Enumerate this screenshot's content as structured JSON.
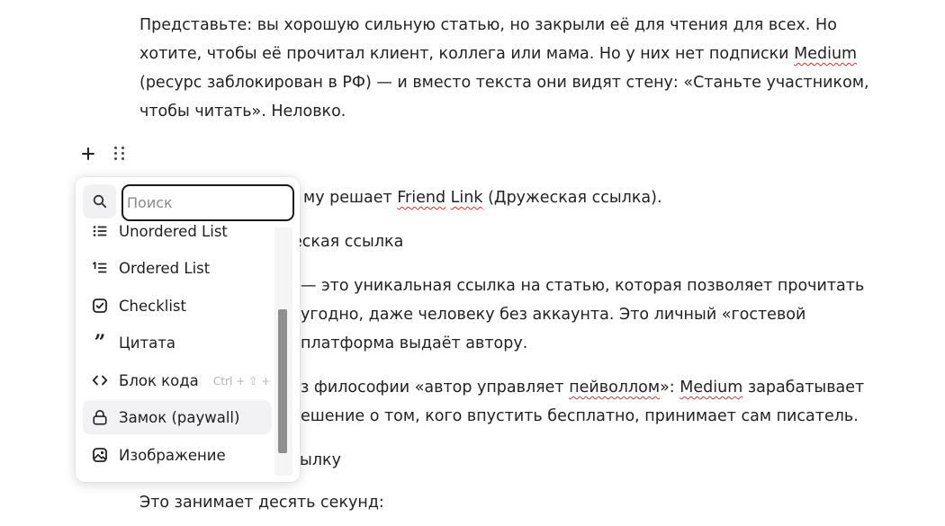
{
  "paragraphs": {
    "intro": {
      "line1": "Представьте: вы хорошую сильную статью, но закрыли её для чтения для всех. Но",
      "line2_a": "хотите, чтобы её прочитал клиент, коллега или мама. Но у них нет подписки ",
      "line2_b": "Medium",
      "line3": "(ресурс заблокирован в РФ) — и вместо текста они видят стену: «Станьте участником,",
      "line4": "чтобы читать». Неловко."
    },
    "p2": {
      "a": "му решает ",
      "b": "Friend",
      "c": " ",
      "d": "Link",
      "e": " (Дружеская ссылка)."
    },
    "p3": "еская ссылка",
    "p4": {
      "line1": "— это уникальная ссылка на статью, которая позволяет прочитать",
      "line2": "угодно, даже человеку без аккаунта. Это личный «гостевой",
      "line3": "платформа выдаёт автору."
    },
    "p5": {
      "line1_a": "з философии «автор управляет ",
      "line1_b": "пейволлом",
      "line1_c": "»: ",
      "line1_d": "Medium",
      "line1_e": " зарабатывает",
      "line2": "ешение о том, кого впустить бесплатно, принимает сам писатель."
    },
    "p6": "ылку",
    "p7": "Это занимает десять секунд:"
  },
  "block_toolbar": {
    "add_icon": "plus-icon",
    "drag_icon": "drag-handle-icon"
  },
  "popup": {
    "search": {
      "icon": "search-icon",
      "placeholder": "Поиск",
      "value": ""
    },
    "items": [
      {
        "label": "Unordered List",
        "icon": "unordered-list-icon",
        "shortcut": ""
      },
      {
        "label": "Ordered List",
        "icon": "ordered-list-icon",
        "shortcut": ""
      },
      {
        "label": "Checklist",
        "icon": "checklist-icon",
        "shortcut": ""
      },
      {
        "label": "Цитата",
        "icon": "quote-icon",
        "shortcut": ""
      },
      {
        "label": "Блок кода",
        "icon": "code-icon",
        "shortcut": "Ctrl + ⇧ + K"
      },
      {
        "label": "Замок (paywall)",
        "icon": "lock-icon",
        "shortcut": "",
        "active": true
      },
      {
        "label": "Изображение",
        "icon": "image-icon",
        "shortcut": ""
      }
    ]
  },
  "colors": {
    "text": "#222222",
    "spellcheck": "#e0302b",
    "active_item_bg": "#f2f2f4",
    "scrollbar_thumb": "#8f8f8f"
  }
}
